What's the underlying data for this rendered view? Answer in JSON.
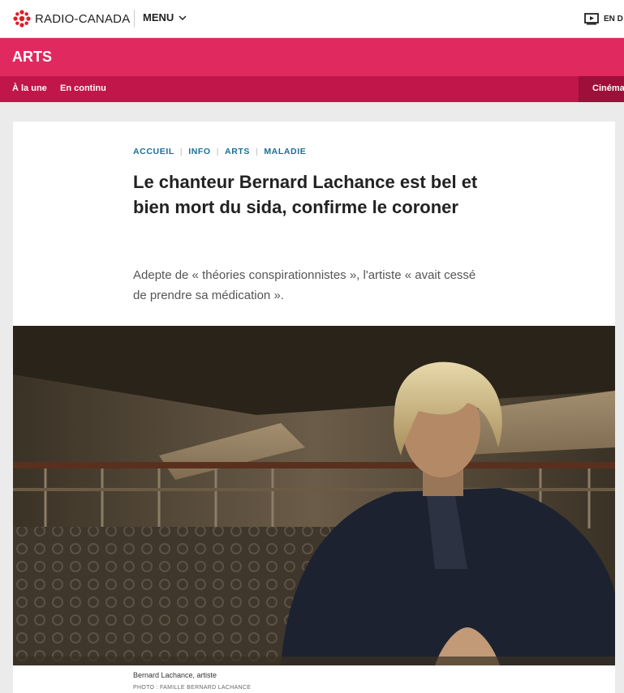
{
  "header": {
    "logo_text": "RADIO-CANADA",
    "menu_label": "MENU",
    "direct_label": "EN D"
  },
  "section": {
    "title": "ARTS",
    "nav": [
      {
        "label": "À la une"
      },
      {
        "label": "En continu"
      }
    ],
    "nav_right": "Cinéma"
  },
  "article": {
    "breadcrumbs": [
      "ACCUEIL",
      "INFO",
      "ARTS",
      "MALADIE"
    ],
    "headline": "Le chanteur Bernard Lachance est bel et bien mort du sida, confirme le coroner",
    "lede": "Adepte de « théories conspirationnistes », l'artiste « avait cessé de prendre sa médication ».",
    "caption": "Bernard Lachance, artiste",
    "credit": "PHOTO : FAMILLE BERNARD LACHANCE"
  },
  "colors": {
    "brand_red": "#e0295e",
    "subnav": "#c0164a",
    "link": "#1a6f94"
  }
}
